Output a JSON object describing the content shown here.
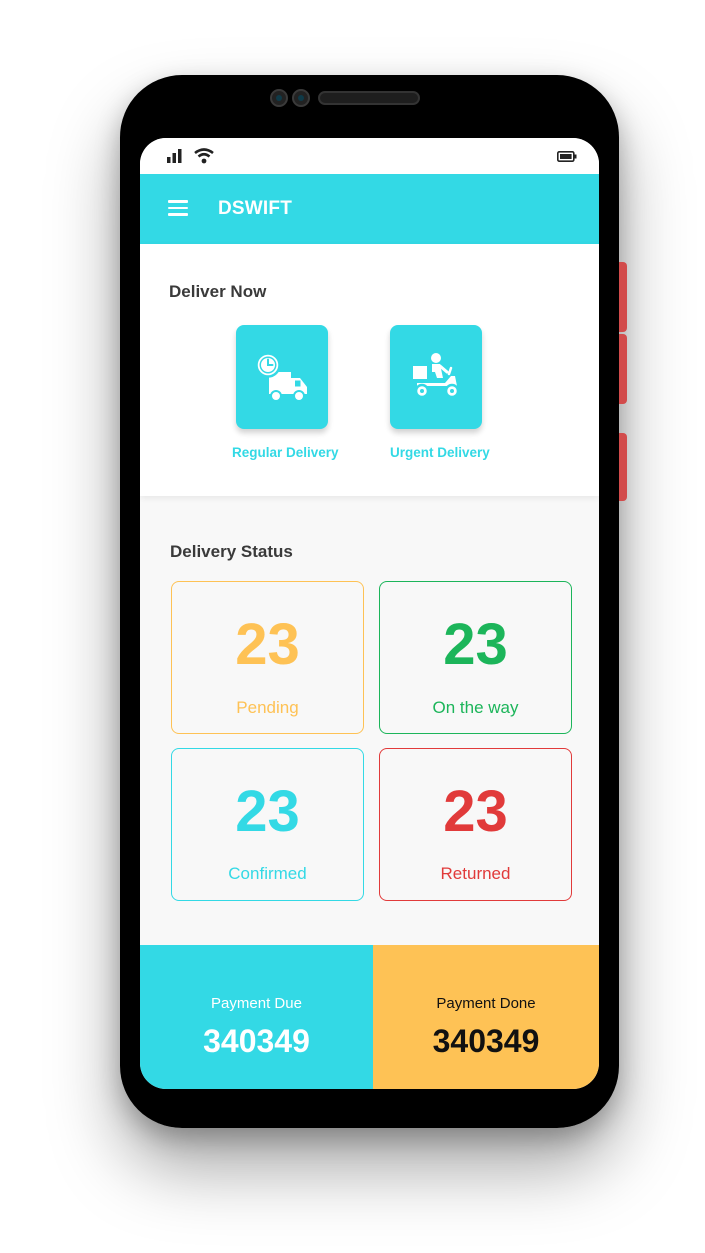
{
  "app": {
    "title": "DSWIFT"
  },
  "icons": {
    "menu": "hamburger-menu-icon",
    "signal": "cellular-signal-icon",
    "wifi": "wifi-icon",
    "battery": "battery-icon"
  },
  "colors": {
    "primary": "#33d9e5",
    "pending": "#fec255",
    "on_the_way": "#1cb55a",
    "confirmed": "#33d9e5",
    "returned": "#e13a3a",
    "payment_done_bg": "#fec255"
  },
  "deliver_now": {
    "title": "Deliver Now",
    "options": [
      {
        "label": "Regular Delivery",
        "icon": "delivery-truck-clock-icon"
      },
      {
        "label": "Urgent Delivery",
        "icon": "delivery-scooter-icon"
      }
    ]
  },
  "delivery_status": {
    "title": "Delivery Status",
    "items": [
      {
        "count": "23",
        "label": "Pending"
      },
      {
        "count": "23",
        "label": "On the way"
      },
      {
        "count": "23",
        "label": "Confirmed"
      },
      {
        "count": "23",
        "label": "Returned"
      }
    ]
  },
  "payments": {
    "due": {
      "label": "Payment Due",
      "value": "340349"
    },
    "done": {
      "label": "Payment Done",
      "value": "340349"
    }
  }
}
